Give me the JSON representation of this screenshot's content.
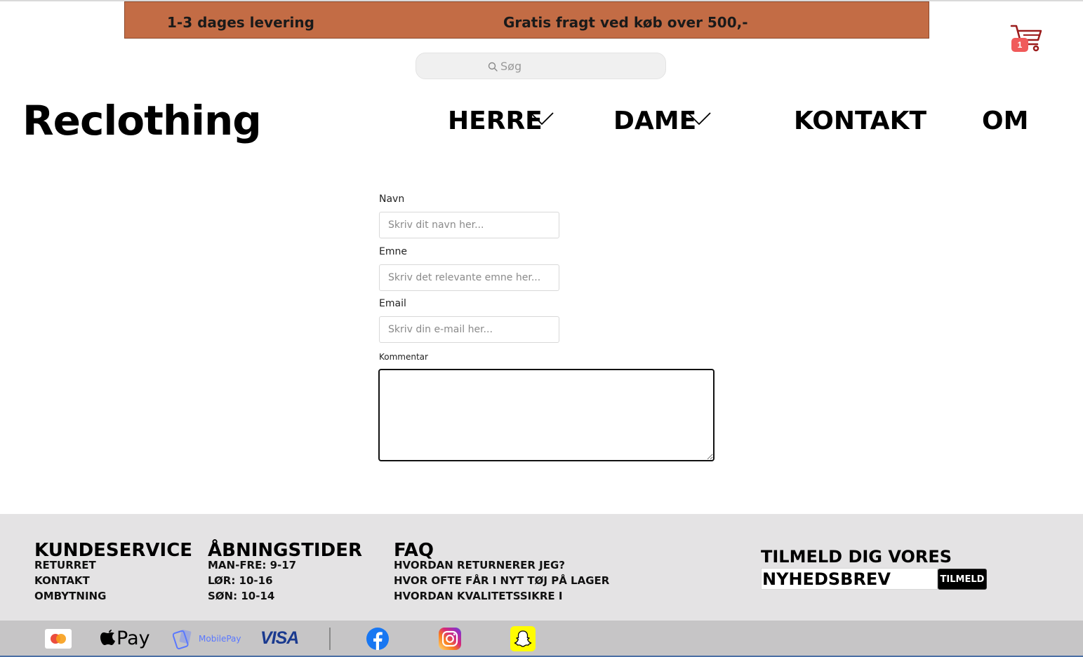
{
  "promo": {
    "left": "1-3 dages levering",
    "right": "Gratis fragt ved køb over 500,-"
  },
  "cart": {
    "count": "1"
  },
  "search": {
    "placeholder": "Søg"
  },
  "brand": {
    "name": "Reclothing"
  },
  "nav": {
    "herre": "HERRE",
    "dame": "DAME",
    "kontakt": "KONTAKT",
    "om": "OM"
  },
  "form": {
    "name_label": "Navn",
    "name_placeholder": "Skriv dit navn her...",
    "subject_label": "Emne",
    "subject_placeholder": "Skriv det relevante emne her...",
    "email_label": "Email",
    "email_placeholder": "Skriv din e-mail her...",
    "comment_label": "Kommentar"
  },
  "footer": {
    "kundeservice": {
      "title": "KUNDESERVICE",
      "links": [
        "RETURRET",
        "KONTAKT",
        "OMBYTNING"
      ]
    },
    "hours": {
      "title": "ÅBNINGSTIDER",
      "lines": [
        "MAN-FRE: 9-17",
        "LØR: 10-16",
        "SØN: 10-14"
      ]
    },
    "faq": {
      "title": "FAQ",
      "links": [
        "HVORDAN RETURNERER JEG?",
        "HVOR OFTE FÅR I NYT TØJ PÅ LAGER",
        "HVORDAN KVALITETSSIKRE I"
      ]
    },
    "newsletter": {
      "title": "TILMELD DIG VORES",
      "input_value": "NYHEDSBREV",
      "button": "TILMELD"
    }
  },
  "payments": {
    "applepay_text": "Pay",
    "mobilepay_text": "MobilePay",
    "visa_text": "VISA"
  },
  "colors": {
    "promo_bg": "#c36c45",
    "footer_bg": "#e4e3e4",
    "payment_bg": "#c6c5c6",
    "cart_color": "#9b1c1c",
    "badge_color": "#f05a5a"
  }
}
